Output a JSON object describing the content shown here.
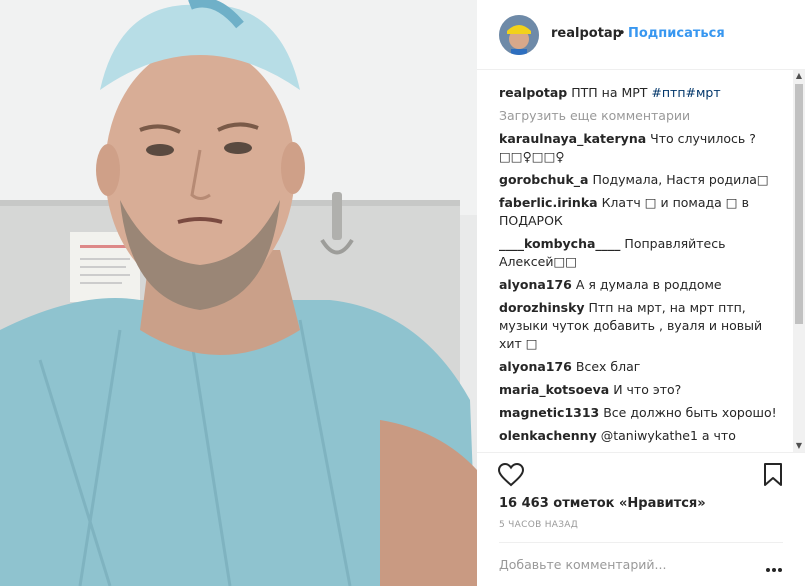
{
  "post": {
    "image_alt": "photo",
    "author": "realpotap",
    "dot": "•",
    "follow_label": "Подписаться",
    "caption": {
      "user": "realpotap",
      "text": "ПТП на МРТ",
      "hashtags": "#птп#мрт"
    }
  },
  "comments": {
    "load_more": "Загрузить еще комментарии",
    "items": [
      {
        "user": "karaulnaya_kateryna",
        "text": "Что случилось ?□□♀□□♀"
      },
      {
        "user": "gorobchuk_a",
        "text": "Подумала, Настя родила□"
      },
      {
        "user": "faberlic.irinka",
        "text": "Клатч □ и помада □ в ПОДАРОК"
      },
      {
        "user": "____kombycha____",
        "text": "Поправляйтесь Алексей□□"
      },
      {
        "user": "alyona176",
        "text": "А я думала в роддоме"
      },
      {
        "user": "dorozhinsky",
        "text": "Птп на мрт, на мрт птп, музыки чуток добавить , вуаля и новый хит □"
      },
      {
        "user": "alyona176",
        "text": "Всех благ"
      },
      {
        "user": "maria_kotsoeva",
        "text": "И что это?"
      },
      {
        "user": "magnetic1313",
        "text": "Все должно быть хорошо!"
      },
      {
        "user": "olenkachenny",
        "text": "@taniwykathe1 а что"
      }
    ]
  },
  "footer": {
    "likes": "16 463 отметок «Нравится»",
    "time": "5 ЧАСОВ НАЗАД",
    "comment_placeholder": "Добавьте комментарий..."
  },
  "icons": {
    "like": "heart-icon",
    "save": "bookmark-icon",
    "more": "more-options-icon"
  },
  "colors": {
    "link": "#3897f0",
    "hashtag": "#003569",
    "muted": "#999999",
    "text": "#262626"
  }
}
